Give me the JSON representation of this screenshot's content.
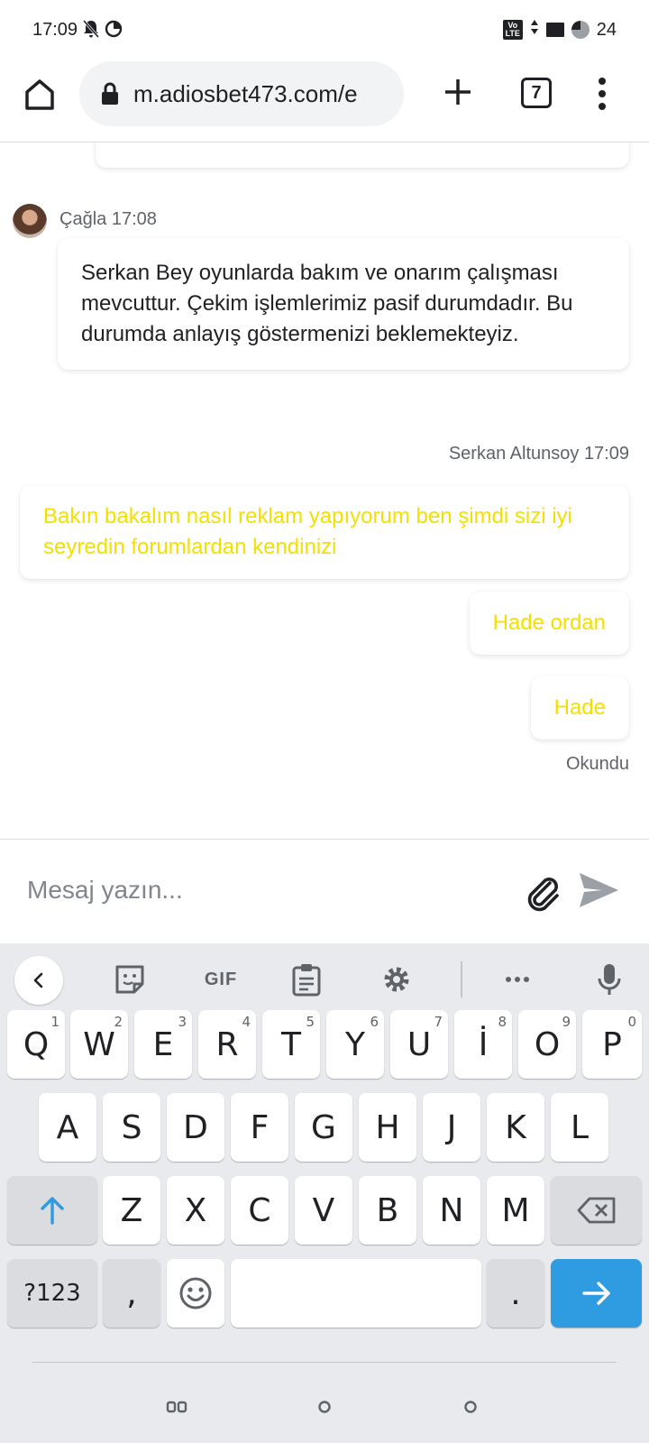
{
  "status_bar": {
    "time": "17:09",
    "battery_level": "24",
    "network_badge": "Vo LTE"
  },
  "browser": {
    "url": "m.adiosbet473.com/e",
    "tab_count": "7"
  },
  "chat": {
    "messages": [
      {
        "sender": "Çağla",
        "time": "17:08",
        "text": "Serkan Bey oyunlarda bakım ve onarım çalışması mevcuttur. Çekim işlemlerimiz pasif durumdadır. Bu durumda anlayış göstermenizi beklemekteyiz."
      },
      {
        "sender": "Serkan Altunsoy",
        "time": "17:09",
        "text": "Bakın bakalım nasıl reklam yapıyorum ben şimdi sizi iyi seyredin forumlardan kendinizi"
      },
      {
        "text": "Hade ordan"
      },
      {
        "text": "Hade"
      }
    ],
    "read_status": "Okundu"
  },
  "composer": {
    "placeholder": "Mesaj yazın..."
  },
  "keyboard": {
    "toolbar_gif": "GIF",
    "rows": {
      "row1": [
        {
          "label": "Q",
          "hint": "1"
        },
        {
          "label": "W",
          "hint": "2"
        },
        {
          "label": "E",
          "hint": "3"
        },
        {
          "label": "R",
          "hint": "4"
        },
        {
          "label": "T",
          "hint": "5"
        },
        {
          "label": "Y",
          "hint": "6"
        },
        {
          "label": "U",
          "hint": "7"
        },
        {
          "label": "İ",
          "hint": "8"
        },
        {
          "label": "O",
          "hint": "9"
        },
        {
          "label": "P",
          "hint": "0"
        }
      ],
      "row2": [
        "A",
        "S",
        "D",
        "F",
        "G",
        "H",
        "J",
        "K",
        "L"
      ],
      "row3": [
        "Z",
        "X",
        "C",
        "V",
        "B",
        "N",
        "M"
      ]
    },
    "symbols_key": "?123",
    "comma_key": ",",
    "period_key": "."
  },
  "colors": {
    "user_message_text": "#f3e000",
    "enter_key": "#2f9be0",
    "shift_arrow": "#2f9be0"
  }
}
